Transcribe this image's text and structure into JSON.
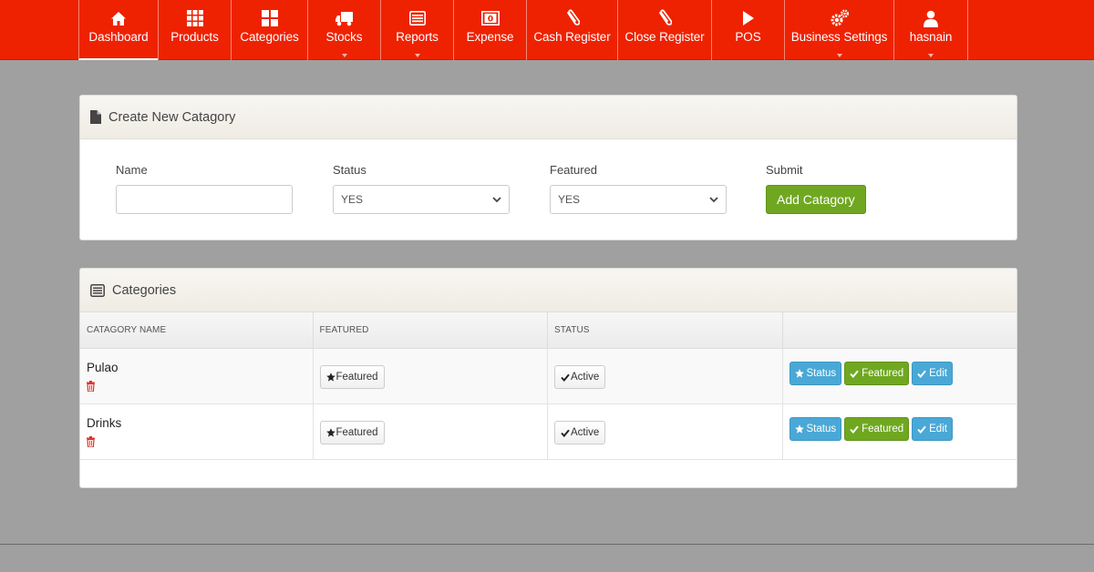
{
  "nav": {
    "items": [
      {
        "label": "Dashboard",
        "icon": "home-icon",
        "active": true,
        "dropdown": false
      },
      {
        "label": "Products",
        "icon": "grid-icon",
        "active": false,
        "dropdown": false
      },
      {
        "label": "Categories",
        "icon": "th-large-icon",
        "active": false,
        "dropdown": false
      },
      {
        "label": "Stocks",
        "icon": "truck-icon",
        "active": false,
        "dropdown": true
      },
      {
        "label": "Reports",
        "icon": "list-alt-icon",
        "active": false,
        "dropdown": true
      },
      {
        "label": "Expense",
        "icon": "money-icon",
        "active": false,
        "dropdown": false
      },
      {
        "label": "Cash Register",
        "icon": "paperclip-icon",
        "active": false,
        "dropdown": false
      },
      {
        "label": "Close Register",
        "icon": "paperclip-icon",
        "active": false,
        "dropdown": false
      },
      {
        "label": "POS",
        "icon": "play-icon",
        "active": false,
        "dropdown": false
      },
      {
        "label": "Business Settings",
        "icon": "cogs-icon",
        "active": false,
        "dropdown": true
      },
      {
        "label": "hasnain",
        "icon": "user-icon",
        "active": false,
        "dropdown": true
      }
    ]
  },
  "create_panel": {
    "title": "Create New Catagory",
    "name_label": "Name",
    "name_value": "",
    "status_label": "Status",
    "status_value": "YES",
    "featured_label": "Featured",
    "featured_value": "YES",
    "submit_label": "Submit",
    "submit_button": "Add Catagory"
  },
  "categories_panel": {
    "title": "Categories",
    "columns": [
      "CATAGORY NAME",
      "FEATURED",
      "STATUS",
      ""
    ],
    "rows": [
      {
        "name": "Pulao",
        "featured_badge": "Featured",
        "status_badge": "Active",
        "btn_status": "Status",
        "btn_featured": "Featured",
        "btn_edit": "Edit"
      },
      {
        "name": "Drinks",
        "featured_badge": "Featured",
        "status_badge": "Active",
        "btn_status": "Status",
        "btn_featured": "Featured",
        "btn_edit": "Edit"
      }
    ]
  },
  "colors": {
    "nav_bg": "#ee2200",
    "page_bg": "#a0a0a0",
    "success": "#6fa820",
    "info": "#4aa8d6",
    "danger": "#d9322a"
  }
}
